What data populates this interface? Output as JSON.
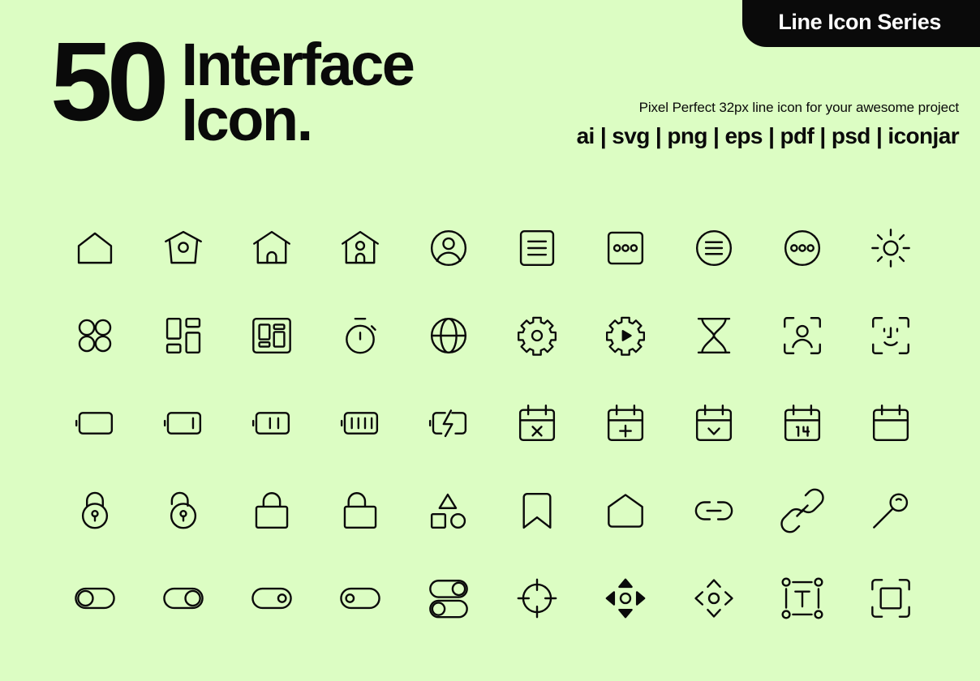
{
  "badge": {
    "label": "Line Icon Series"
  },
  "headline": {
    "count": "50",
    "line1": "Interface",
    "line2": "Icon."
  },
  "description": {
    "subtitle": "Pixel Perfect 32px line icon for your awesome project",
    "formats": "ai | svg | png | eps | pdf | psd | iconjar"
  },
  "theme": {
    "background": "#dcfdc3",
    "ink": "#0a0a0a",
    "badge_background": "#0a0a0a",
    "badge_text": "#ffffff"
  },
  "grid": {
    "columns": 10,
    "rows": 5,
    "total_icons": 50,
    "calendar_day_label": "14",
    "text_box_label": "T",
    "icons": [
      "home-outline-icon",
      "home-window-icon",
      "home-door-icon",
      "home-window-door-icon",
      "user-circle-icon",
      "menu-square-icon",
      "dots-square-icon",
      "menu-circle-icon",
      "dots-circle-icon",
      "brightness-sun-icon",
      "grid-circles-icon",
      "layout-dashboard-icon",
      "layout-framed-icon",
      "stopwatch-icon",
      "globe-icon",
      "settings-gear-icon",
      "gear-play-icon",
      "hourglass-icon",
      "face-scan-icon",
      "face-id-icon",
      "battery-empty-icon",
      "battery-low-icon",
      "battery-medium-icon",
      "battery-full-icon",
      "battery-charging-icon",
      "calendar-remove-icon",
      "calendar-add-icon",
      "calendar-check-icon",
      "calendar-date-icon",
      "calendar-blank-icon",
      "lock-round-closed-icon",
      "lock-round-open-icon",
      "lock-square-closed-icon",
      "lock-square-open-icon",
      "shapes-icon",
      "bookmark-icon",
      "pentagon-home-icon",
      "link-horizontal-icon",
      "link-diagonal-icon",
      "key-pin-icon",
      "toggle-left-large-icon",
      "toggle-right-large-icon",
      "toggle-right-small-icon",
      "toggle-left-small-icon",
      "toggle-stacked-icon",
      "crosshair-target-icon",
      "move-arrows-icon",
      "resize-arrows-icon",
      "text-box-icon",
      "crop-frame-icon"
    ]
  }
}
